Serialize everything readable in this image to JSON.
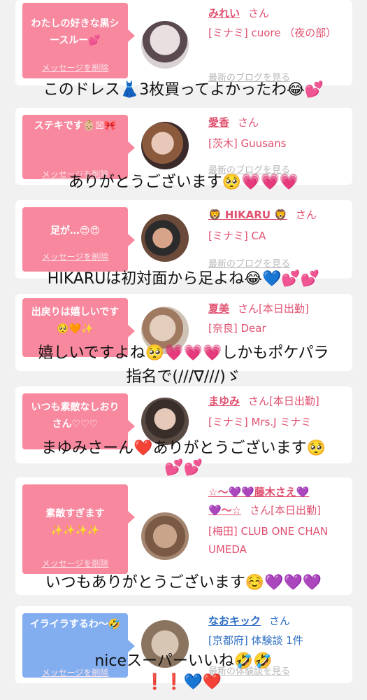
{
  "cards": [
    {
      "bubble": "わたしの好きな黒シースルー💕",
      "delete_label": "メッセージを削除",
      "name": "みれい",
      "suffix": "さん",
      "shop": "[ミナミ] cuore （夜の部）",
      "blog": "最新のブログを見る",
      "caption": "このドレス👗3枚買ってよかったわ😂💕"
    },
    {
      "bubble": "ステキです👶🏼☒🎀",
      "delete_label": "メッセージを削除",
      "name": "愛香",
      "suffix": "さん",
      "shop": "[茨木] Guusans",
      "blog": "最新のブログを見る",
      "caption": "ありがとうございます🥺💗💗💗"
    },
    {
      "bubble": "足が…😍😍",
      "delete_label": "メッセージを削除",
      "name": "🦁 HIKARU 🦁",
      "suffix": "さん",
      "shop": "[ミナミ] CA",
      "blog": "最新のブログを見る",
      "caption": "HIKARUは初対面から足よね😂💙💕💕"
    },
    {
      "bubble": "出戻りは嬉しいです🥺🧡✨",
      "delete_label": "メッセージを削除",
      "name": "夏美",
      "suffix": "さん[本日出勤]",
      "shop": "[奈良] Dear",
      "blog": "最新のブログを見る",
      "caption": "嬉しいですよね🥺💗💗💗しかもポケパラ",
      "caption2": "指名で(///∇///)ゞ"
    },
    {
      "bubble": "いつも素敵なしおりさん♡♡♡",
      "delete_label": "メッセージを削除",
      "name": "まゆみ",
      "suffix": "さん[本日出勤]",
      "shop": "[ミナミ] Mrs.J ミナミ",
      "blog": "最新のブログを見る",
      "caption": "まゆみさーん❤️ありがとうございます🥺",
      "caption2": "💕💕"
    },
    {
      "bubble": "素敵すぎます✨✨✨✨",
      "delete_label": "メッセージを削除",
      "name": "☆〜💜💜藤木さえ💜",
      "name2": "💜〜☆",
      "suffix": "さん[本日出勤]",
      "shop": "[梅田] CLUB ONE CHAN UMEDA",
      "blog": "最新のブログを見る",
      "caption": "いつもありがとうございます☺️💜💜💜"
    },
    {
      "bubble": "イライラするわ〜🤣",
      "delete_label": "メッセージを削除",
      "name": "なおキック",
      "suffix": "さん",
      "shop": "[京都府] 体験談 1件",
      "blog": "最新の体験談を見る",
      "caption": "niceスーパーいいね🤣🤣",
      "caption2": "❗️❗️💙❤️"
    }
  ],
  "colors": {
    "bubble_pink": "#f7889e",
    "bubble_blue": "#82aef0",
    "name_pink": "#e0506f",
    "name_blue": "#2f6fc4"
  }
}
